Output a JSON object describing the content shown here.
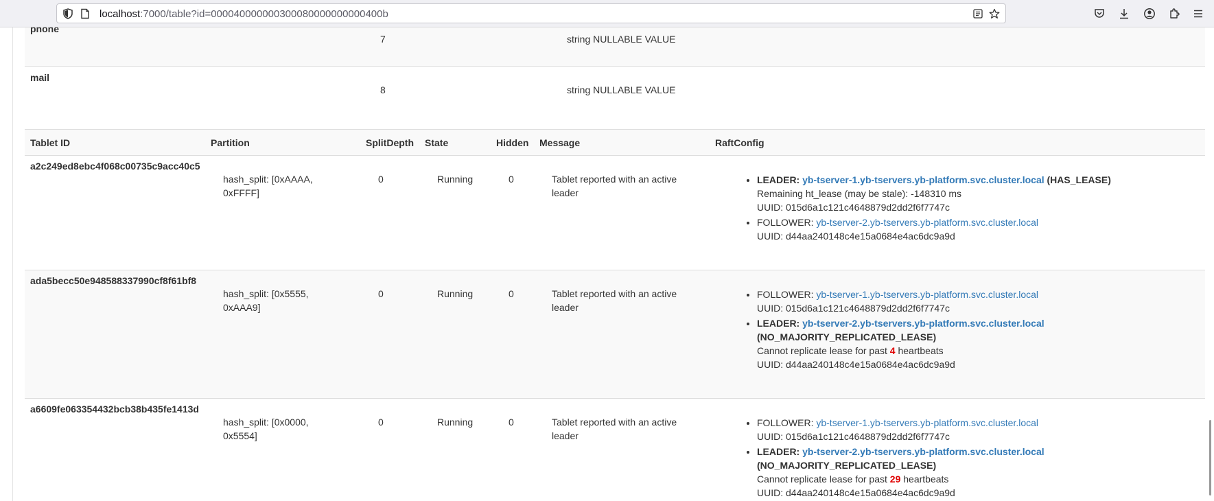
{
  "browser": {
    "url_host": "localhost",
    "url_path": ":7000/table?id=000040000000300080000000000400b"
  },
  "columns_table": {
    "rows": [
      {
        "name": "phone",
        "id": "7",
        "type": "string NULLABLE VALUE"
      },
      {
        "name": "mail",
        "id": "8",
        "type": "string NULLABLE VALUE"
      }
    ]
  },
  "tablets": {
    "headers": [
      "Tablet ID",
      "Partition",
      "SplitDepth",
      "State",
      "Hidden",
      "Message",
      "RaftConfig"
    ],
    "rows": [
      {
        "id": "a2c249ed8ebc4f068c00735c9acc40c5",
        "partition_l1": "hash_split: [0xAAAA,",
        "partition_l2": "0xFFFF]",
        "split_depth": "0",
        "state": "Running",
        "hidden": "0",
        "message_l1": "Tablet reported with an active",
        "message_l2": "leader",
        "peers": [
          {
            "role": "LEADER:",
            "host": "yb-tserver-1.yb-tservers.yb-platform.svc.cluster.local",
            "lease": "(HAS_LEASE)",
            "note": "Remaining ht_lease (may be stale): -148310 ms",
            "uuid": "UUID: 015d6a1c121c4648879d2dd2f6f7747c"
          },
          {
            "role": "FOLLOWER:",
            "host": "yb-tserver-2.yb-tservers.yb-platform.svc.cluster.local",
            "uuid": "UUID: d44aa240148c4e15a0684e4ac6dc9a9d"
          }
        ]
      },
      {
        "id": "ada5becc50e948588337990cf8f61bf8",
        "partition_l1": "hash_split: [0x5555,",
        "partition_l2": "0xAAA9]",
        "split_depth": "0",
        "state": "Running",
        "hidden": "0",
        "message_l1": "Tablet reported with an active",
        "message_l2": "leader",
        "peers": [
          {
            "role": "FOLLOWER:",
            "host": "yb-tserver-1.yb-tservers.yb-platform.svc.cluster.local",
            "uuid": "UUID: 015d6a1c121c4648879d2dd2f6f7747c"
          },
          {
            "role": "LEADER:",
            "host": "yb-tserver-2.yb-tservers.yb-platform.svc.cluster.local",
            "lease": "(NO_MAJORITY_REPLICATED_LEASE)",
            "note_pre": "Cannot replicate lease for past",
            "note_num": "4",
            "note_post": "heartbeats",
            "uuid": "UUID: d44aa240148c4e15a0684e4ac6dc9a9d"
          }
        ]
      },
      {
        "id": "a6609fe063354432bcb38b435fe1413d",
        "partition_l1": "hash_split: [0x0000,",
        "partition_l2": "0x5554]",
        "split_depth": "0",
        "state": "Running",
        "hidden": "0",
        "message_l1": "Tablet reported with an active",
        "message_l2": "leader",
        "peers": [
          {
            "role": "FOLLOWER:",
            "host": "yb-tserver-1.yb-tservers.yb-platform.svc.cluster.local",
            "uuid": "UUID: 015d6a1c121c4648879d2dd2f6f7747c"
          },
          {
            "role": "LEADER:",
            "host": "yb-tserver-2.yb-tservers.yb-platform.svc.cluster.local",
            "lease": "(NO_MAJORITY_REPLICATED_LEASE)",
            "note_pre": "Cannot replicate lease for past",
            "note_num": "29",
            "note_post": "heartbeats",
            "uuid": "UUID: d44aa240148c4e15a0684e4ac6dc9a9d"
          }
        ]
      }
    ]
  }
}
